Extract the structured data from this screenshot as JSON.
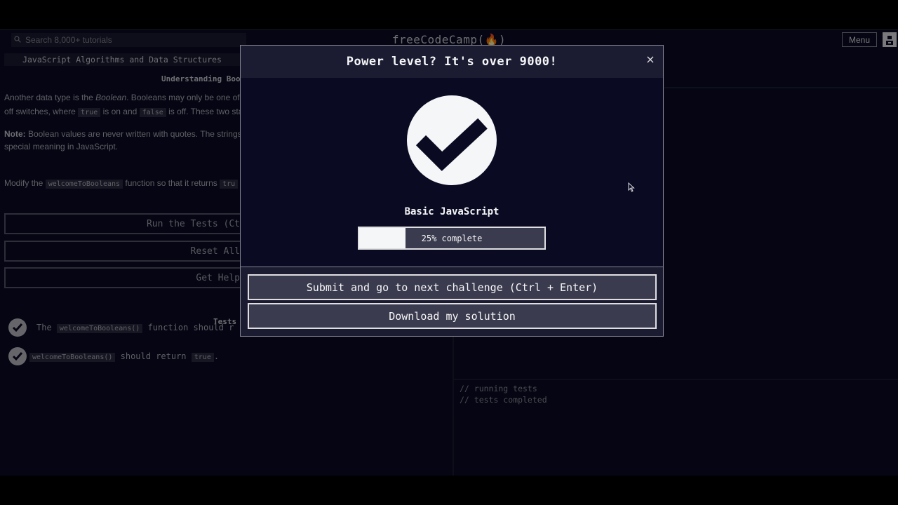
{
  "navbar": {
    "search_placeholder": "Search 8,000+ tutorials",
    "brand": "freeCodeCamp(🔥)",
    "menu_label": "Menu"
  },
  "lesson": {
    "breadcrumb": "JavaScript Algorithms and Data Structures",
    "title": "Understanding Boo",
    "para1_line1": [
      "Another data type is the ",
      "Boolean",
      ". Booleans may only be one of tw"
    ],
    "para1_line2": [
      "off switches, where ",
      "true",
      " is on and ",
      "false",
      " is off. These two stat"
    ],
    "note_label": "Note:",
    "note_line1": " Boolean values are never written with quotes. The strings",
    "note_line2": "special meaning in JavaScript.",
    "instr": [
      "Modify the ",
      "welcomeToBooleans",
      " function so that it returns ",
      "tru"
    ],
    "buttons": {
      "run": "Run the Tests (Ct",
      "reset": "Reset All",
      "help": "Get Help"
    },
    "tests_heading": "Tests",
    "tests": [
      {
        "pre": "The ",
        "code": "welcomeToBooleans()",
        "post": " function should r"
      },
      {
        "pre": "",
        "code": "welcomeToBooleans()",
        "post": " should return ",
        "code2": "true",
        "post2": "."
      }
    ]
  },
  "console": {
    "lines": [
      "// running tests",
      "// tests completed"
    ]
  },
  "modal": {
    "title": "Power level? It's over 9000!",
    "close_symbol": "×",
    "block_title": "Basic JavaScript",
    "progress_percent": 25,
    "progress_label": "25% complete",
    "submit_label": "Submit and go to next challenge (Ctrl + Enter)",
    "download_label": "Download my solution"
  },
  "icons": {
    "search": "search-icon",
    "success": "check-circle-icon",
    "close": "close-icon",
    "test_pass": "check-icon",
    "avatar": "avatar-icon"
  },
  "colors": {
    "background": "#0a0a23",
    "panel": "#1b1b32",
    "button": "#3b3b4f",
    "text": "#f5f6f7"
  }
}
